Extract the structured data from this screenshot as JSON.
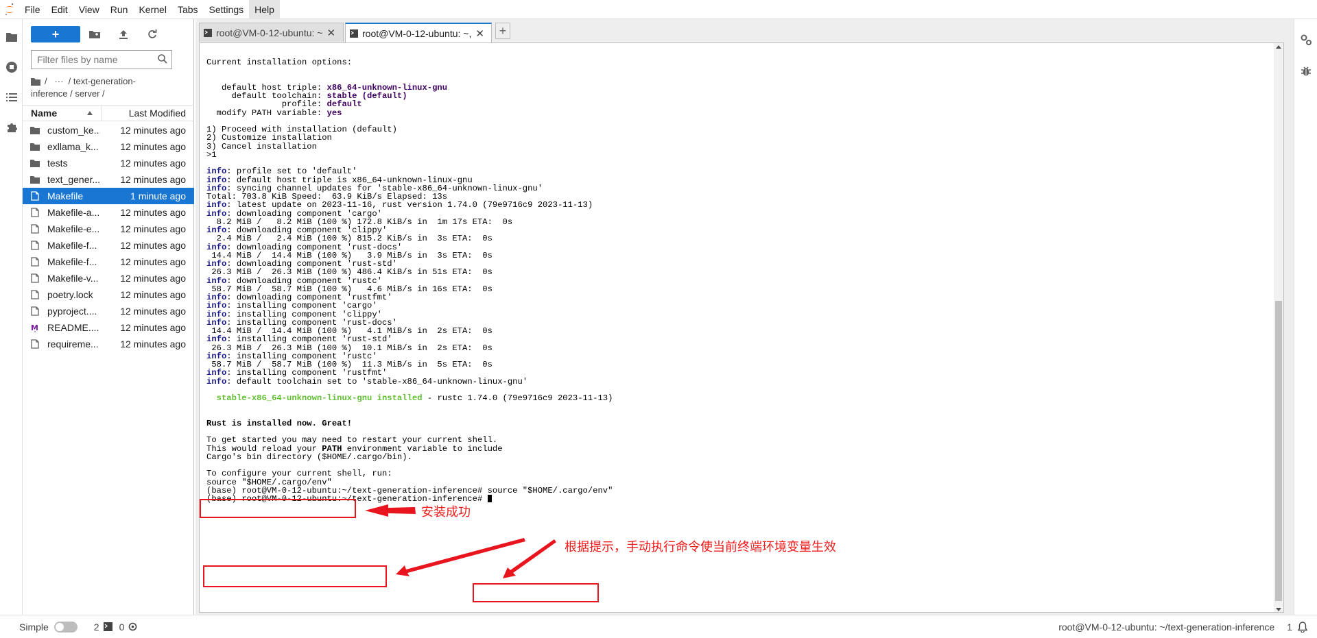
{
  "menu": {
    "items": [
      "File",
      "Edit",
      "View",
      "Run",
      "Kernel",
      "Tabs",
      "Settings",
      "Help"
    ],
    "active_index": 7
  },
  "filebrowser": {
    "new_label": "+",
    "filter_placeholder": "Filter files by name",
    "breadcrumb_line1": "/   ···  / text-generation-",
    "breadcrumb_line2": "inference / server /",
    "col_name": "Name",
    "col_modified": "Last Modified",
    "files": [
      {
        "name": "custom_ke...",
        "modified": "12 minutes ago",
        "icon": "folder-icon"
      },
      {
        "name": "exllama_k...",
        "modified": "12 minutes ago",
        "icon": "folder-icon"
      },
      {
        "name": "tests",
        "modified": "12 minutes ago",
        "icon": "folder-icon"
      },
      {
        "name": "text_gener...",
        "modified": "12 minutes ago",
        "icon": "folder-icon"
      },
      {
        "name": "Makefile",
        "modified": "1 minute ago",
        "icon": "file-icon",
        "selected": true
      },
      {
        "name": "Makefile-a...",
        "modified": "12 minutes ago",
        "icon": "file-icon"
      },
      {
        "name": "Makefile-e...",
        "modified": "12 minutes ago",
        "icon": "file-icon"
      },
      {
        "name": "Makefile-f...",
        "modified": "12 minutes ago",
        "icon": "file-icon"
      },
      {
        "name": "Makefile-f...",
        "modified": "12 minutes ago",
        "icon": "file-icon"
      },
      {
        "name": "Makefile-v...",
        "modified": "12 minutes ago",
        "icon": "file-icon"
      },
      {
        "name": "poetry.lock",
        "modified": "12 minutes ago",
        "icon": "file-icon"
      },
      {
        "name": "pyproject....",
        "modified": "12 minutes ago",
        "icon": "file-icon"
      },
      {
        "name": "README....",
        "modified": "12 minutes ago",
        "icon": "markdown-icon"
      },
      {
        "name": "requireme...",
        "modified": "12 minutes ago",
        "icon": "file-icon"
      }
    ]
  },
  "tabs": [
    {
      "label": "root@VM-0-12-ubuntu: ~",
      "active": false
    },
    {
      "label": "root@VM-0-12-ubuntu: ~,",
      "active": true
    }
  ],
  "terminal": {
    "lines": [
      [
        {
          "t": "Current installation options:"
        }
      ],
      [
        {
          "t": ""
        }
      ],
      [
        {
          "t": ""
        }
      ],
      [
        {
          "t": "   default host triple: "
        },
        {
          "t": "x86_64-unknown-linux-gnu",
          "c": "b purple"
        }
      ],
      [
        {
          "t": "     default toolchain: "
        },
        {
          "t": "stable (default)",
          "c": "b purple"
        }
      ],
      [
        {
          "t": "               profile: "
        },
        {
          "t": "default",
          "c": "b purple"
        }
      ],
      [
        {
          "t": "  modify PATH variable: "
        },
        {
          "t": "yes",
          "c": "b purple"
        }
      ],
      [
        {
          "t": ""
        }
      ],
      [
        {
          "t": "1) Proceed with installation (default)"
        }
      ],
      [
        {
          "t": "2) Customize installation"
        }
      ],
      [
        {
          "t": "3) Cancel installation"
        }
      ],
      [
        {
          "t": ">1"
        }
      ],
      [
        {
          "t": ""
        }
      ],
      [
        {
          "t": "info",
          "c": "b blue"
        },
        {
          "t": ": profile set to 'default'"
        }
      ],
      [
        {
          "t": "info",
          "c": "b blue"
        },
        {
          "t": ": default host triple is x86_64-unknown-linux-gnu"
        }
      ],
      [
        {
          "t": "info",
          "c": "b blue"
        },
        {
          "t": ": syncing channel updates for 'stable-x86_64-unknown-linux-gnu'"
        }
      ],
      [
        {
          "t": "Total: 703.8 KiB Speed:  63.9 KiB/s Elapsed: 13s"
        }
      ],
      [
        {
          "t": "info",
          "c": "b blue"
        },
        {
          "t": ": latest update on 2023-11-16, rust version 1.74.0 (79e9716c9 2023-11-13)"
        }
      ],
      [
        {
          "t": "info",
          "c": "b blue"
        },
        {
          "t": ": downloading component 'cargo'"
        }
      ],
      [
        {
          "t": "  8.2 MiB /   8.2 MiB (100 %) 172.8 KiB/s in  1m 17s ETA:  0s"
        }
      ],
      [
        {
          "t": "info",
          "c": "b blue"
        },
        {
          "t": ": downloading component 'clippy'"
        }
      ],
      [
        {
          "t": "  2.4 MiB /   2.4 MiB (100 %) 815.2 KiB/s in  3s ETA:  0s"
        }
      ],
      [
        {
          "t": "info",
          "c": "b blue"
        },
        {
          "t": ": downloading component 'rust-docs'"
        }
      ],
      [
        {
          "t": " 14.4 MiB /  14.4 MiB (100 %)   3.9 MiB/s in  3s ETA:  0s"
        }
      ],
      [
        {
          "t": "info",
          "c": "b blue"
        },
        {
          "t": ": downloading component 'rust-std'"
        }
      ],
      [
        {
          "t": " 26.3 MiB /  26.3 MiB (100 %) 486.4 KiB/s in 51s ETA:  0s"
        }
      ],
      [
        {
          "t": "info",
          "c": "b blue"
        },
        {
          "t": ": downloading component 'rustc'"
        }
      ],
      [
        {
          "t": " 58.7 MiB /  58.7 MiB (100 %)   4.6 MiB/s in 16s ETA:  0s"
        }
      ],
      [
        {
          "t": "info",
          "c": "b blue"
        },
        {
          "t": ": downloading component 'rustfmt'"
        }
      ],
      [
        {
          "t": "info",
          "c": "b blue"
        },
        {
          "t": ": installing component 'cargo'"
        }
      ],
      [
        {
          "t": "info",
          "c": "b blue"
        },
        {
          "t": ": installing component 'clippy'"
        }
      ],
      [
        {
          "t": "info",
          "c": "b blue"
        },
        {
          "t": ": installing component 'rust-docs'"
        }
      ],
      [
        {
          "t": " 14.4 MiB /  14.4 MiB (100 %)   4.1 MiB/s in  2s ETA:  0s"
        }
      ],
      [
        {
          "t": "info",
          "c": "b blue"
        },
        {
          "t": ": installing component 'rust-std'"
        }
      ],
      [
        {
          "t": " 26.3 MiB /  26.3 MiB (100 %)  10.1 MiB/s in  2s ETA:  0s"
        }
      ],
      [
        {
          "t": "info",
          "c": "b blue"
        },
        {
          "t": ": installing component 'rustc'"
        }
      ],
      [
        {
          "t": " 58.7 MiB /  58.7 MiB (100 %)  11.3 MiB/s in  5s ETA:  0s"
        }
      ],
      [
        {
          "t": "info",
          "c": "b blue"
        },
        {
          "t": ": installing component 'rustfmt'"
        }
      ],
      [
        {
          "t": "info",
          "c": "b blue"
        },
        {
          "t": ": default toolchain set to 'stable-x86_64-unknown-linux-gnu'"
        }
      ],
      [
        {
          "t": ""
        }
      ],
      [
        {
          "t": "  "
        },
        {
          "t": "stable-x86_64-unknown-linux-gnu installed",
          "c": "green"
        },
        {
          "t": " - rustc 1.74.0 (79e9716c9 2023-11-13)"
        }
      ],
      [
        {
          "t": ""
        }
      ],
      [
        {
          "t": ""
        }
      ],
      [
        {
          "t": "Rust is installed now. Great!",
          "c": "b"
        }
      ],
      [
        {
          "t": ""
        }
      ],
      [
        {
          "t": "To get started you may need to restart your current shell."
        }
      ],
      [
        {
          "t": "This would reload your "
        },
        {
          "t": "PATH",
          "c": "b"
        },
        {
          "t": " environment variable to include"
        }
      ],
      [
        {
          "t": "Cargo's bin directory ($HOME/.cargo/bin)."
        }
      ],
      [
        {
          "t": ""
        }
      ],
      [
        {
          "t": "To configure your current shell, run:"
        }
      ],
      [
        {
          "t": "source \"$HOME/.cargo/env\""
        }
      ],
      [
        {
          "t": "(base) root@VM-0-12-ubuntu:~/text-generation-inference# source \"$HOME/.cargo/env\""
        }
      ],
      [
        {
          "t": "(base) root@VM-0-12-ubuntu:~/text-generation-inference# "
        }
      ]
    ]
  },
  "annotations": {
    "install_success": "安装成功",
    "run_hint": "根据提示，手动执行命令使当前终端环境变量生效"
  },
  "status": {
    "simple_label": "Simple",
    "kernels_count": "2",
    "terminals_count": "0",
    "right_text": "root@VM-0-12-ubuntu: ~/text-generation-inference",
    "right_count": "1"
  },
  "colors": {
    "accent": "#1976d2",
    "annotation_red": "#e8141e",
    "terminal_info": "#1a1a8a",
    "terminal_green": "#5fbf2f"
  }
}
